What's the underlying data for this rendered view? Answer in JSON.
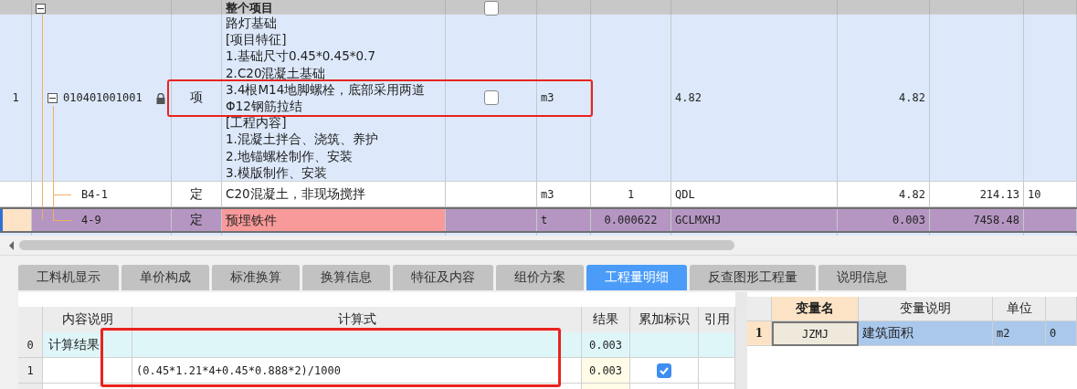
{
  "top_table": {
    "header": {
      "title": "整个项目",
      "expanded": true,
      "checked": false
    },
    "rows": [
      {
        "kind": "bill",
        "selected": false,
        "row_number": "1",
        "code": "010401001001",
        "expanded": true,
        "locked": true,
        "type": "项",
        "description_lines": [
          "路灯基础",
          "[项目特征]",
          "1.基础尺寸0.45*0.45*0.7",
          "2.C20混凝土基础",
          "3.4根M14地脚螺栓，底部采用两道",
          "Φ12钢筋拉结",
          "[工程内容]",
          "1.混凝土拌合、浇筑、养护",
          "2.地锚螺栓制作、安装",
          "3.模版制作、安装"
        ],
        "checked": false,
        "unit": "m3",
        "factor": "",
        "expression": "4.82",
        "quantity": "4.82",
        "price": "",
        "column_11": ""
      },
      {
        "kind": "quota",
        "selected": false,
        "row_number": "",
        "code": "B4-1",
        "type": "定",
        "description_lines": [
          "C20混凝土，非现场搅拌"
        ],
        "flagged": false,
        "unit": "m3",
        "factor": "1",
        "expression": "QDL",
        "quantity": "4.82",
        "price": "214.13",
        "column_11": "10"
      },
      {
        "kind": "quota",
        "selected": true,
        "row_number": "",
        "code": "4-9",
        "type": "定",
        "description_lines": [
          "预埋铁件"
        ],
        "flagged": true,
        "unit": "t",
        "factor": "0.000622",
        "expression": "GCLMXHJ",
        "quantity": "0.003",
        "price": "7458.48",
        "column_11": ""
      }
    ]
  },
  "tabs": [
    {
      "label": "工料机显示",
      "selected": false
    },
    {
      "label": "单价构成",
      "selected": false
    },
    {
      "label": "标准换算",
      "selected": false
    },
    {
      "label": "换算信息",
      "selected": false
    },
    {
      "label": "特征及内容",
      "selected": false
    },
    {
      "label": "组价方案",
      "selected": false
    },
    {
      "label": "工程量明细",
      "selected": true
    },
    {
      "label": "反查图形工程量",
      "selected": false
    },
    {
      "label": "说明信息",
      "selected": false
    }
  ],
  "calc_table": {
    "columns": [
      "内容说明",
      "计算式",
      "结果",
      "累加标识",
      "引用"
    ],
    "rows": [
      {
        "kind": "total",
        "row_number": "0",
        "description": "计算结果",
        "formula": "",
        "result": "0.003"
      },
      {
        "kind": "line",
        "row_number": "1",
        "description": "",
        "formula": "(0.45*1.21*4+0.45*0.888*2)/1000",
        "result": "0.003",
        "checked": true
      }
    ]
  },
  "variable_table": {
    "columns": [
      "变量名",
      "变量说明",
      "单位"
    ],
    "rows": [
      {
        "selected": true,
        "row_number": "1",
        "name": "JZMJ",
        "description": "建筑面积",
        "unit": "m2",
        "column_5": "0"
      }
    ]
  }
}
